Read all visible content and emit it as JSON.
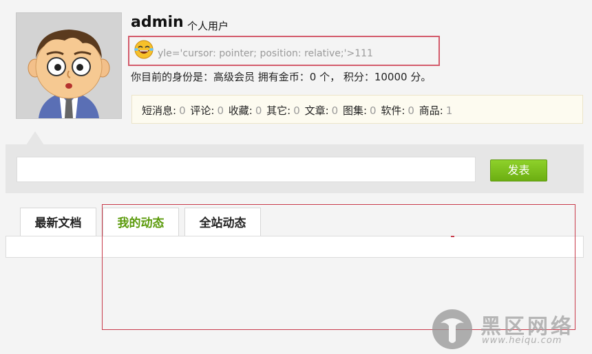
{
  "profile": {
    "username": "admin",
    "user_type": "个人用户",
    "signature_text": "yle='cursor: pointer; position: relative;'>111",
    "status_line": "你目前的身份是：高级会员 拥有金币：0 个， 积分：10000 分。"
  },
  "stats": [
    {
      "label": "短消息:",
      "value": "0"
    },
    {
      "label": "评论:",
      "value": "0"
    },
    {
      "label": "收藏:",
      "value": "0"
    },
    {
      "label": "其它:",
      "value": "0"
    },
    {
      "label": "文章:",
      "value": "0"
    },
    {
      "label": "图集:",
      "value": "0"
    },
    {
      "label": "软件:",
      "value": "0"
    },
    {
      "label": "商品:",
      "value": "1"
    }
  ],
  "composer": {
    "input_value": "",
    "post_label": "发表"
  },
  "tabs": [
    {
      "label": "最新文档",
      "active": false
    },
    {
      "label": "我的动态",
      "active": true
    },
    {
      "label": "全站动态",
      "active": false
    }
  ],
  "watermark": {
    "title": "黑区网络",
    "url": "www.heiqu.com"
  },
  "colors": {
    "accent_green": "#6cae12",
    "active_tab_text": "#5a9a0a",
    "highlight_red": "#c83a4a"
  },
  "icons": {
    "avatar": "cartoon-man-avatar",
    "emoji": "laughing-tears-emoji",
    "logo": "heiqu-logo"
  }
}
